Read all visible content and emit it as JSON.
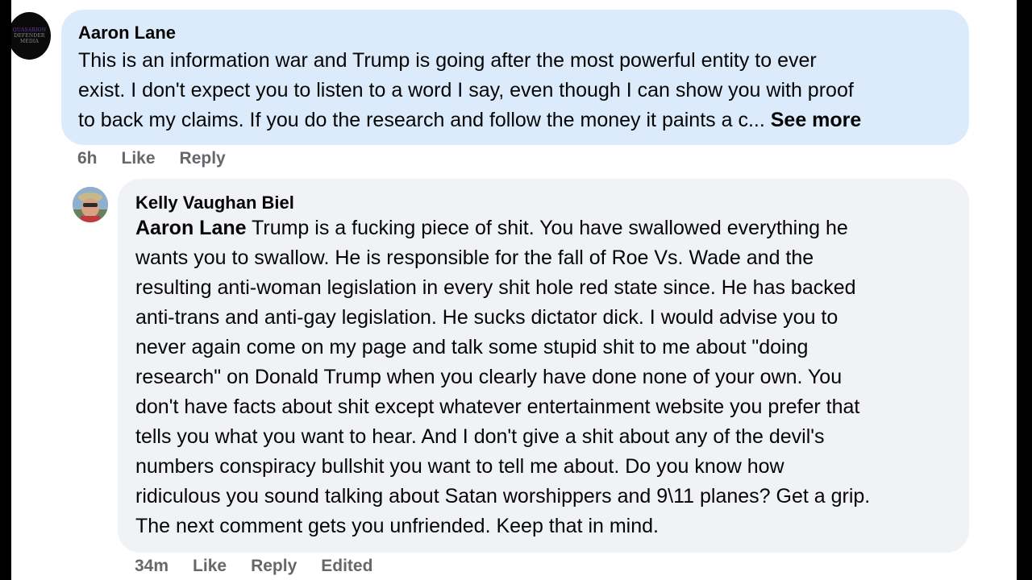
{
  "colors": {
    "background_side": "#000000",
    "page": "#ffffff",
    "bubble_highlight": "#dcebfb",
    "bubble_default": "#f0f2f5",
    "text_primary": "#050505",
    "text_secondary": "#65676b"
  },
  "comments": [
    {
      "avatar_icon": "profile-photo",
      "avatar_text": [
        "QUASARION",
        "DEFENDER",
        "MEDIA"
      ],
      "author": "Aaron Lane",
      "lines": [
        "This is an information war and Trump is going after the most powerful entity to ever",
        "exist. I don't expect you to listen to a word I say, even though I can show you with proof",
        "to back my claims. If you do the research and follow the money it paints a c..."
      ],
      "see_more": "See more",
      "time": "6h",
      "like": "Like",
      "reply": "Reply"
    },
    {
      "avatar_icon": "profile-photo",
      "author": "Kelly Vaughan Biel",
      "mention": "Aaron Lane",
      "first_line_rest": " Trump is a fucking piece of shit. You have swallowed everything he",
      "lines": [
        "wants you to swallow. He is responsible for the fall of Roe Vs. Wade and the",
        "resulting anti-woman legislation in every shit hole red state since. He has backed",
        "anti-trans and anti-gay legislation. He sucks dictator dick. I would advise you to",
        "never again come on my page and talk some stupid shit to me about \"doing",
        "research\" on Donald Trump when you clearly have done none of your own. You",
        "don't have facts about shit except whatever entertainment website you prefer that",
        "tells you what you want to hear. And I don't give a shit about any of the devil's",
        "numbers conspiracy bullshit you want to tell me about. Do you know how",
        "ridiculous you sound talking about Satan worshippers and 9\\11 planes? Get a grip.",
        "The next comment gets you unfriended. Keep that in mind."
      ],
      "time": "34m",
      "like": "Like",
      "reply": "Reply",
      "edited": "Edited"
    }
  ]
}
